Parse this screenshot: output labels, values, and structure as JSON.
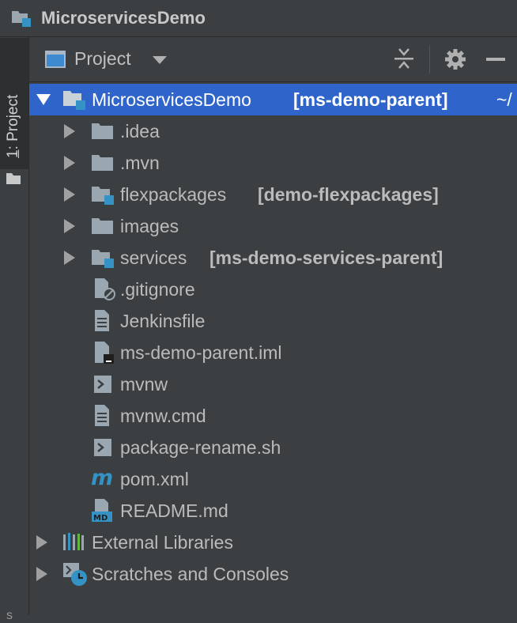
{
  "project_title": "MicroservicesDemo",
  "stripe": {
    "tab_number": "1",
    "tab_rest": ": Project",
    "bottom_char": "s"
  },
  "header": {
    "view_label": "Project"
  },
  "tree": {
    "root": {
      "name": "MicroservicesDemo",
      "module": "[ms-demo-parent]",
      "path": "~/"
    },
    "items": [
      {
        "name": ".idea",
        "module": ""
      },
      {
        "name": ".mvn",
        "module": ""
      },
      {
        "name": "flexpackages",
        "module": "[demo-flexpackages]"
      },
      {
        "name": "images",
        "module": ""
      },
      {
        "name": "services",
        "module": "[ms-demo-services-parent]"
      },
      {
        "name": ".gitignore",
        "module": ""
      },
      {
        "name": "Jenkinsfile",
        "module": ""
      },
      {
        "name": "ms-demo-parent.iml",
        "module": ""
      },
      {
        "name": "mvnw",
        "module": ""
      },
      {
        "name": "mvnw.cmd",
        "module": ""
      },
      {
        "name": "package-rename.sh",
        "module": ""
      },
      {
        "name": "pom.xml",
        "module": ""
      },
      {
        "name": "README.md",
        "module": ""
      }
    ],
    "external_libraries": "External Libraries",
    "scratches": "Scratches and Consoles"
  },
  "icons": {
    "project": "module-folder-icon",
    "folder": "folder-icon",
    "module_folder": "module-folder-icon",
    "gitignore": "ignored-file-icon",
    "text_file": "text-file-icon",
    "iml": "iml-file-icon",
    "shell": "shell-script-icon",
    "maven": "maven-pom-icon",
    "markdown": "markdown-file-icon",
    "libraries": "libraries-icon",
    "scratches": "scratches-icon"
  },
  "colors": {
    "background": "#3c3f41",
    "selection": "#2f65ca",
    "module_badge": "#3592c4",
    "folder": "#9aa7b0",
    "text": "#bbbbbb"
  }
}
